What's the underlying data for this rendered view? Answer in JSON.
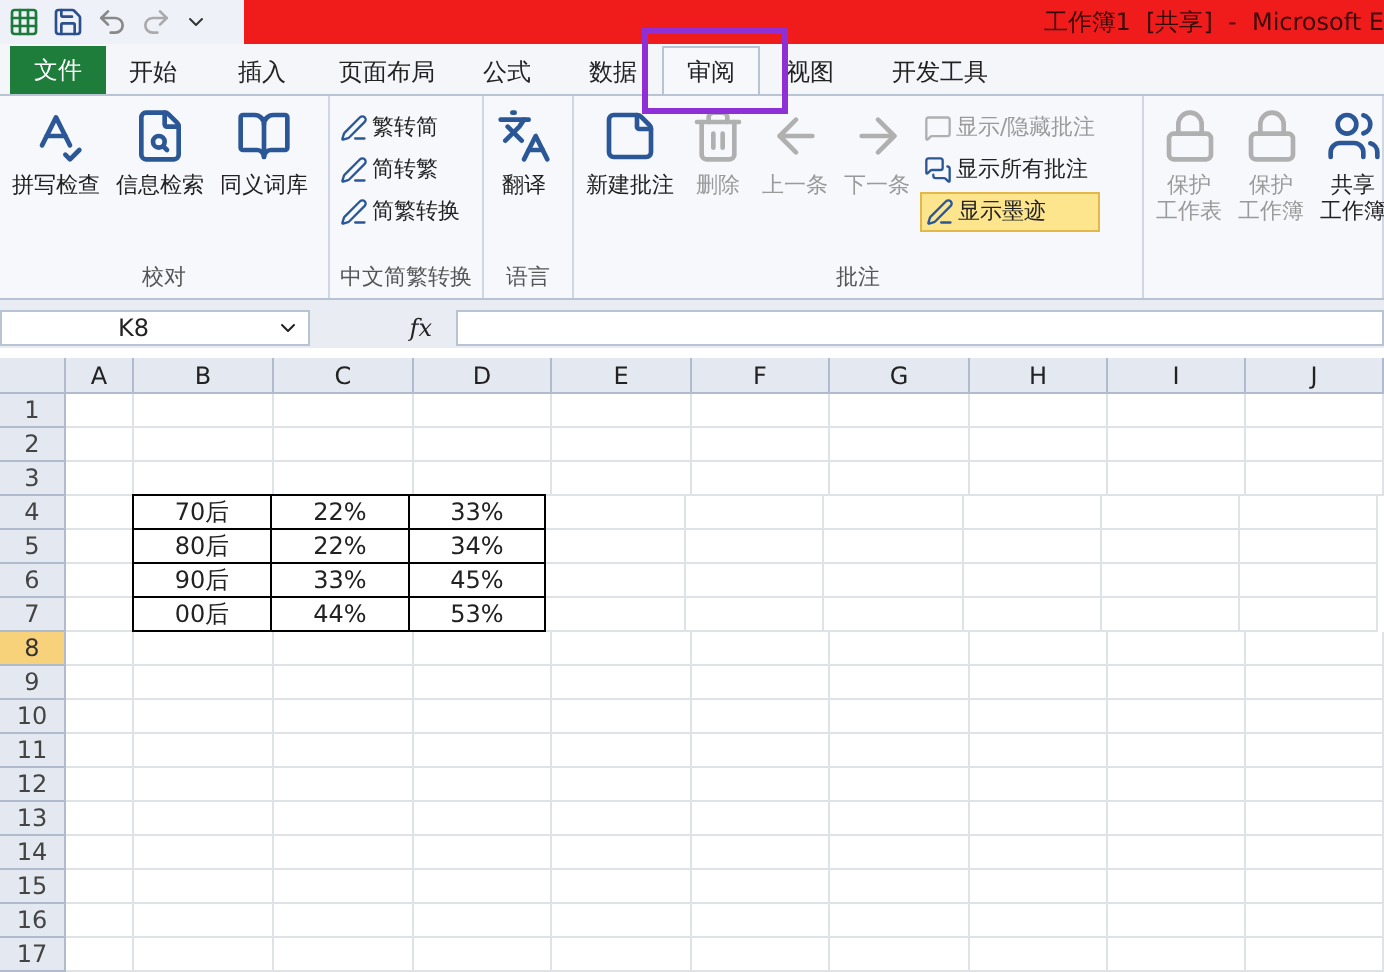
{
  "window": {
    "title": "工作簿1  [共享]  -  Microsoft E"
  },
  "tabs": [
    {
      "label": "文件",
      "kind": "file",
      "selected": false
    },
    {
      "label": "开始",
      "kind": "tab",
      "selected": false
    },
    {
      "label": "插入",
      "kind": "tab",
      "selected": false
    },
    {
      "label": "页面布局",
      "kind": "tab",
      "selected": false
    },
    {
      "label": "公式",
      "kind": "tab",
      "selected": false
    },
    {
      "label": "数据",
      "kind": "tab",
      "selected": false
    },
    {
      "label": "审阅",
      "kind": "tab",
      "selected": true
    },
    {
      "label": "视图",
      "kind": "tab",
      "selected": false
    },
    {
      "label": "开发工具",
      "kind": "tab",
      "selected": false
    }
  ],
  "ribbon": {
    "groups": [
      {
        "label": "校对",
        "buttons": [
          {
            "label": "拼写检查",
            "kind": "large",
            "disabled": false,
            "selected": false
          },
          {
            "label": "信息检索",
            "kind": "large",
            "disabled": false,
            "selected": false
          },
          {
            "label": "同义词库",
            "kind": "large",
            "disabled": false,
            "selected": false
          }
        ]
      },
      {
        "label": "中文简繁转换",
        "buttons": [
          {
            "label": "繁转简",
            "kind": "small",
            "disabled": false,
            "selected": false
          },
          {
            "label": "简转繁",
            "kind": "small",
            "disabled": false,
            "selected": false
          },
          {
            "label": "简繁转换",
            "kind": "small",
            "disabled": false,
            "selected": false
          }
        ]
      },
      {
        "label": "语言",
        "buttons": [
          {
            "label": "翻译",
            "kind": "large",
            "disabled": false,
            "selected": false
          }
        ]
      },
      {
        "label": "批注",
        "buttons": [
          {
            "label": "新建批注",
            "kind": "large",
            "disabled": false,
            "selected": false
          },
          {
            "label": "删除",
            "kind": "large",
            "disabled": true,
            "selected": false
          },
          {
            "label": "上一条",
            "kind": "large",
            "disabled": true,
            "selected": false
          },
          {
            "label": "下一条",
            "kind": "large",
            "disabled": true,
            "selected": false
          },
          {
            "label": "显示/隐藏批注",
            "kind": "small",
            "disabled": true,
            "selected": false
          },
          {
            "label": "显示所有批注",
            "kind": "small",
            "disabled": false,
            "selected": false
          },
          {
            "label": "显示墨迹",
            "kind": "small",
            "disabled": false,
            "selected": true
          }
        ]
      },
      {
        "buttons": [
          {
            "lines": [
              "保护",
              "工作表"
            ],
            "kind": "large",
            "disabled": true,
            "selected": false
          },
          {
            "lines": [
              "保护",
              "工作簿"
            ],
            "kind": "large",
            "disabled": true,
            "selected": false
          },
          {
            "lines": [
              "共享",
              "工作簿"
            ],
            "kind": "large",
            "disabled": false,
            "selected": false
          }
        ]
      }
    ]
  },
  "formula_bar": {
    "name_box": "K8",
    "fx": "fx"
  },
  "sheet": {
    "columns": [
      "A",
      "B",
      "C",
      "D",
      "E",
      "F",
      "G",
      "H",
      "I",
      "J"
    ],
    "rows": [
      {
        "label": "1",
        "selected": false
      },
      {
        "label": "2",
        "selected": false
      },
      {
        "label": "3",
        "selected": false
      },
      {
        "label": "4",
        "selected": false,
        "cells": {
          "B": "70后",
          "C": "22%",
          "D": "33%"
        }
      },
      {
        "label": "5",
        "selected": false,
        "cells": {
          "B": "80后",
          "C": "22%",
          "D": "34%"
        }
      },
      {
        "label": "6",
        "selected": false,
        "cells": {
          "B": "90后",
          "C": "33%",
          "D": "45%"
        }
      },
      {
        "label": "7",
        "selected": false,
        "cells": {
          "B": "00后",
          "C": "44%",
          "D": "53%"
        }
      },
      {
        "label": "8",
        "selected": true
      },
      {
        "label": "9",
        "selected": false
      },
      {
        "label": "10",
        "selected": false
      },
      {
        "label": "11",
        "selected": false
      },
      {
        "label": "12",
        "selected": false
      },
      {
        "label": "13",
        "selected": false
      },
      {
        "label": "14",
        "selected": false
      },
      {
        "label": "15",
        "selected": false
      },
      {
        "label": "16",
        "selected": false
      },
      {
        "label": "17",
        "selected": false
      }
    ]
  }
}
